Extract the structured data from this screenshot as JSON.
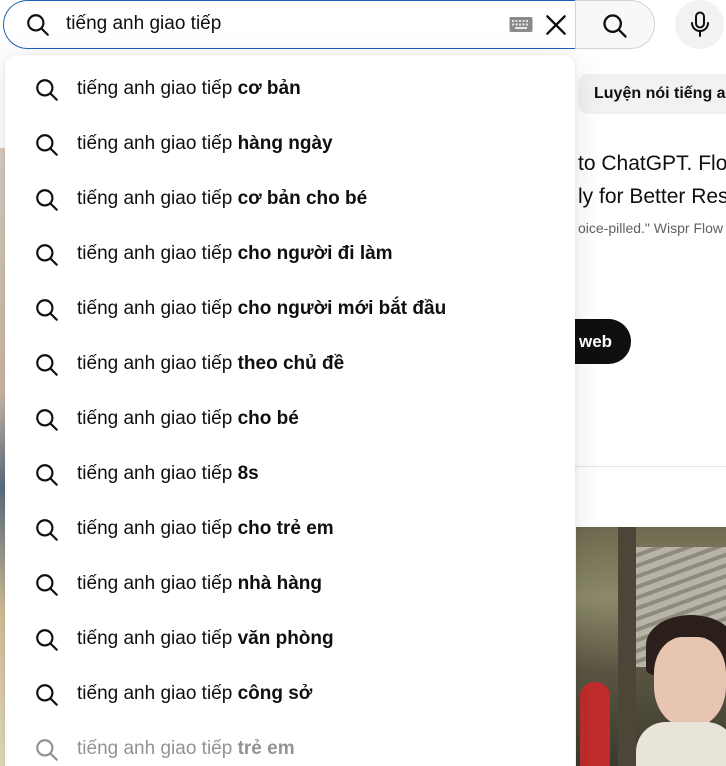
{
  "search": {
    "query": "tiếng anh giao tiếp",
    "keyboard_icon": "keyboard-icon",
    "clear_icon": "close-icon",
    "search_icon": "search-icon",
    "mic_icon": "microphone-icon"
  },
  "background": {
    "chip_label": "Luyện nói tiếng a",
    "ad_title_line1": "to ChatGPT. Flo",
    "ad_title_line2": "ly for Better Res",
    "ad_subtitle": "oice-pilled.\" Wispr Flow",
    "ad_cta": "web"
  },
  "suggestions": [
    {
      "prefix": "tiếng anh giao tiếp ",
      "suffix": "cơ bản"
    },
    {
      "prefix": "tiếng anh giao tiếp ",
      "suffix": "hàng ngày"
    },
    {
      "prefix": "tiếng anh giao tiếp ",
      "suffix": "cơ bản cho bé"
    },
    {
      "prefix": "tiếng anh giao tiếp ",
      "suffix": "cho người đi làm"
    },
    {
      "prefix": "tiếng anh giao tiếp ",
      "suffix": "cho người mới bắt đầu"
    },
    {
      "prefix": "tiếng anh giao tiếp ",
      "suffix": "theo chủ đề"
    },
    {
      "prefix": "tiếng anh giao tiếp ",
      "suffix": "cho bé"
    },
    {
      "prefix": "tiếng anh giao tiếp ",
      "suffix": "8s"
    },
    {
      "prefix": "tiếng anh giao tiếp ",
      "suffix": "cho trẻ em"
    },
    {
      "prefix": "tiếng anh giao tiếp ",
      "suffix": "nhà hàng"
    },
    {
      "prefix": "tiếng anh giao tiếp ",
      "suffix": "văn phòng"
    },
    {
      "prefix": "tiếng anh giao tiếp ",
      "suffix": "công sở"
    },
    {
      "prefix": "tiếng anh giao tiếp ",
      "suffix": "trẻ em"
    }
  ],
  "colors": {
    "focus_border": "#1c62b9",
    "text": "#0f0f0f",
    "secondary_text": "#606060"
  }
}
